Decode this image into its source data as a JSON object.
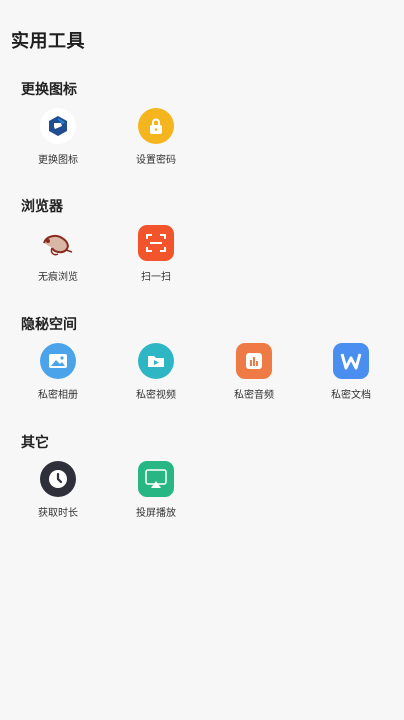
{
  "page": {
    "title": "实用工具"
  },
  "sections": [
    {
      "title": "更换图标",
      "items": [
        {
          "label": "更换图标",
          "icon": "app-logo-icon"
        },
        {
          "label": "设置密码",
          "icon": "lock-icon"
        }
      ]
    },
    {
      "title": "浏览器",
      "items": [
        {
          "label": "无痕浏览",
          "icon": "chameleon-icon"
        },
        {
          "label": "扫一扫",
          "icon": "scan-icon"
        }
      ]
    },
    {
      "title": "隐秘空间",
      "items": [
        {
          "label": "私密相册",
          "icon": "photo-album-icon"
        },
        {
          "label": "私密视频",
          "icon": "video-icon"
        },
        {
          "label": "私密音频",
          "icon": "audio-icon"
        },
        {
          "label": "私密文档",
          "icon": "document-icon"
        }
      ]
    },
    {
      "title": "其它",
      "items": [
        {
          "label": "获取时长",
          "icon": "clock-icon"
        },
        {
          "label": "投屏播放",
          "icon": "screen-cast-icon"
        }
      ]
    }
  ],
  "colors": {
    "background": "#f7f7f7",
    "lock": "#f5b51f",
    "scan": "#f2552c",
    "album": "#4ba4ea",
    "video": "#2fb6c4",
    "audio": "#ee7a46",
    "document": "#4a8ef0",
    "clock": "#2f2f3a",
    "screen_cast": "#28b685"
  }
}
